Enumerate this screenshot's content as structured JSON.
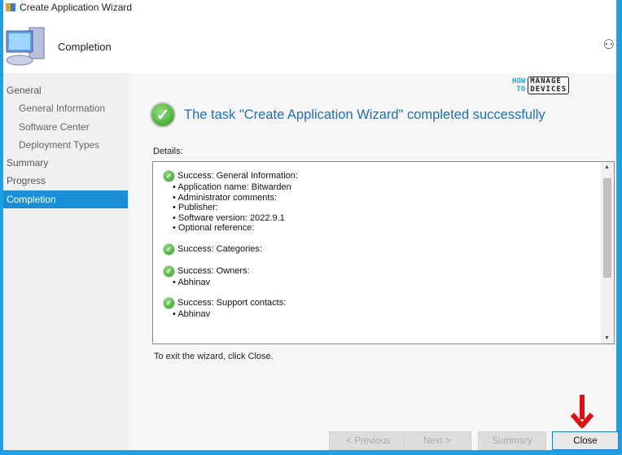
{
  "window": {
    "title": "Create Application Wizard"
  },
  "header": {
    "page_title": "Completion"
  },
  "nav": {
    "items": [
      {
        "label": "General",
        "sub": false
      },
      {
        "label": "General Information",
        "sub": true
      },
      {
        "label": "Software Center",
        "sub": true
      },
      {
        "label": "Deployment Types",
        "sub": true
      },
      {
        "label": "Summary",
        "sub": false
      },
      {
        "label": "Progress",
        "sub": false
      },
      {
        "label": "Completion",
        "sub": false,
        "active": true
      }
    ]
  },
  "logo": {
    "how": "HOW",
    "to": "TO",
    "manage": "MANAGE",
    "devices": "DEVICES"
  },
  "main": {
    "status": "The task \"Create Application Wizard\" completed successfully",
    "details_label": "Details:",
    "details": [
      {
        "heading": "Success: General Information:",
        "items": [
          "Application name: Bitwarden",
          "Administrator comments:",
          "Publisher:",
          "Software version: 2022.9.1",
          "Optional reference:"
        ]
      },
      {
        "heading": "Success: Categories:",
        "items": []
      },
      {
        "heading": "Success: Owners:",
        "items": [
          "Abhinav"
        ]
      },
      {
        "heading": "Success: Support contacts:",
        "items": [
          "Abhinav"
        ]
      }
    ],
    "exit_text": "To exit the wizard, click Close."
  },
  "buttons": {
    "previous": "< Previous",
    "next": "Next >",
    "summary": "Summary",
    "close": "Close"
  },
  "colors": {
    "accent": "#1a8fd8",
    "frame": "#1ea0e6",
    "arrow": "#e01010"
  }
}
